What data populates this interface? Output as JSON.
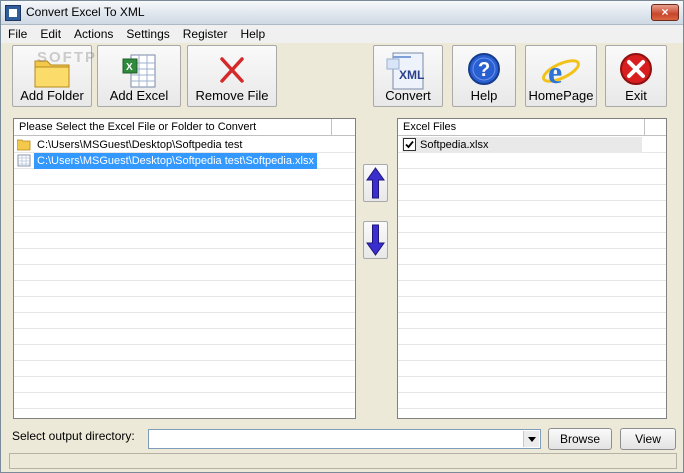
{
  "window": {
    "title": "Convert Excel To XML",
    "close_label": "×"
  },
  "menu": [
    "File",
    "Edit",
    "Actions",
    "Settings",
    "Register",
    "Help"
  ],
  "toolbar": {
    "add_folder": "Add Folder",
    "add_excel": "Add Excel",
    "remove_file": "Remove File",
    "convert": "Convert",
    "help": "Help",
    "homepage": "HomePage",
    "exit": "Exit",
    "watermark": "SOFTPE",
    "convert_icon_text": "XML"
  },
  "left_panel": {
    "header": "Please Select the Excel File or Folder to Convert",
    "items": [
      {
        "icon": "folder-icon",
        "text": "C:\\Users\\MSGuest\\Desktop\\Softpedia test",
        "selected": false
      },
      {
        "icon": "excel-file-icon",
        "text": "C:\\Users\\MSGuest\\Desktop\\Softpedia test\\Softpedia.xlsx",
        "selected": true
      }
    ]
  },
  "right_panel": {
    "header": "Excel Files",
    "items": [
      {
        "checked": true,
        "text": "Softpedia.xlsx"
      }
    ]
  },
  "output": {
    "label": "Select  output directory:",
    "value": "",
    "browse": "Browse",
    "view": "View"
  },
  "colors": {
    "selection": "#3399ff",
    "accent_blue": "#2a5fd1",
    "exit_red": "#d81e1e"
  }
}
